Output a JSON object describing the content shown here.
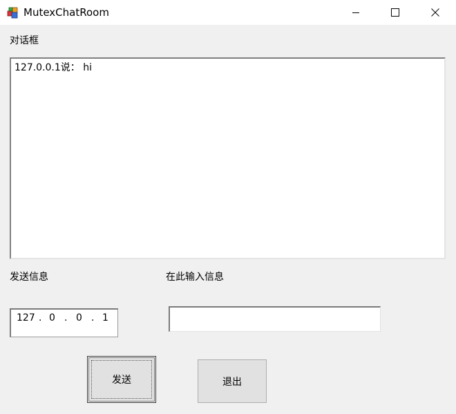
{
  "window": {
    "title": "MutexChatRoom"
  },
  "labels": {
    "dialog": "对话框",
    "send_info": "发送信息",
    "input_hint": "在此输入信息"
  },
  "chat": {
    "messages": [
      "127.0.0.1说： hi"
    ]
  },
  "ip_address": {
    "octets": [
      "127",
      "0",
      "0",
      "1"
    ]
  },
  "message_input": {
    "value": ""
  },
  "buttons": {
    "send": "发送",
    "exit": "退出"
  }
}
